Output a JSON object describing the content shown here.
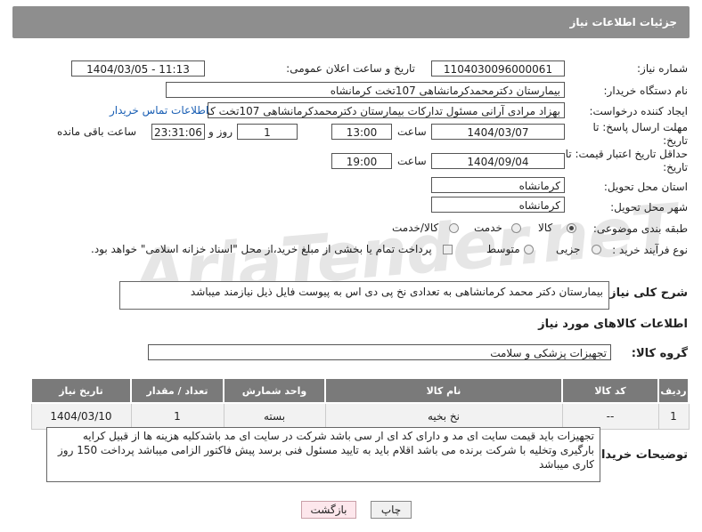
{
  "header": {
    "title": "جزئیات اطلاعات نیاز"
  },
  "watermark": {
    "text": "AriaTender.neT"
  },
  "form": {
    "need_number_label": "شماره نیاز:",
    "need_number": "1104030096000061",
    "announce_label": "تاریخ و ساعت اعلان عمومی:",
    "announce_value": "1404/03/05 - 11:13",
    "buyer_org_label": "نام دستگاه خریدار:",
    "buyer_org": "بیمارستان دکترمحمدکرمانشاهی 107تخت کرمانشاه",
    "requester_label": "ایجاد کننده درخواست:",
    "requester": "بهزاد مرادی آرانی مسئول تدارکات بیمارستان دکترمحمدکرمانشاهی 107تخت کر",
    "contact_link": "اطلاعات تماس خریدار",
    "deadline_label": "مهلت ارسال پاسخ: تا تاریخ:",
    "deadline_date": "1404/03/07",
    "time_label": "ساعت",
    "deadline_time": "13:00",
    "day_value": "1",
    "day_and_label": "روز و",
    "remaining_time": "23:31:06",
    "remaining_label": "ساعت باقی مانده",
    "price_validity_label": "حداقل تاریخ اعتبار قیمت: تا تاریخ:",
    "price_validity_date": "1404/09/04",
    "price_validity_time": "19:00",
    "province_label": "استان محل تحویل:",
    "province": "کرمانشاه",
    "city_label": "شهر محل تحویل:",
    "city": "کرمانشاه",
    "category_label": "طبقه بندی موضوعی:",
    "category_options": [
      "کالا",
      "خدمت",
      "کالا/خدمت"
    ],
    "process_label": "نوع فرآیند خرید :",
    "process_options": [
      "جزیی",
      "متوسط"
    ],
    "payment_note": "پرداخت تمام یا بخشی از مبلغ خرید،از محل \"اسناد خزانه اسلامی\" خواهد بود.",
    "description_label": "شرح کلی نیاز:",
    "description": "بیمارستان دکتر محمد کرمانشاهی به تعدادی نخ پی دی اس به پیوست فایل ذیل نیازمند میباشد"
  },
  "goods": {
    "section_title": "اطلاعات کالاهای مورد نیاز",
    "group_label": "گروه کالا:",
    "group_value": "تجهیزات پزشکی و سلامت",
    "columns": [
      "ردیف",
      "کد کالا",
      "نام کالا",
      "واحد شمارش",
      "تعداد / مقدار",
      "تاریخ نیاز"
    ],
    "rows": [
      {
        "row": "1",
        "code": "--",
        "name": "نخ بخیه",
        "unit": "بسته",
        "qty": "1",
        "date": "1404/03/10"
      }
    ]
  },
  "buyer_notes": {
    "label": "توضیحات خریدار:",
    "text": "تجهیزات باید قیمت سایت ای مد و دارای کد ای ار سی باشد شرکت در سایت ای مد باشدکلیه هزینه ها از قبیل کرایه بارگیری وتخلیه با شرکت برنده می باشد اقلام باید به تایید مسئول فنی  برسد پیش فاکتور الزامی میباشد پرداخت 150 روز کاری میباشد"
  },
  "buttons": {
    "print": "چاپ",
    "back": "بازگشت"
  }
}
